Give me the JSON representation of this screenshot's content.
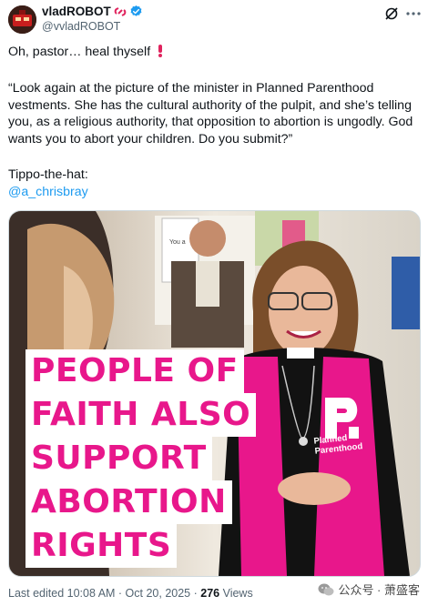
{
  "header": {
    "display_name": "vladROBOT",
    "handle": "@vvladROBOT"
  },
  "tweet": {
    "line1": "Oh, pastor… heal thyself",
    "line2": "“Look again at the picture of the minister in Planned Parenthood vestments. She has the cultural authority of the pulpit, and she’s telling you, as a religious authority, that opposition to abortion is ungodly. God wants you to abort your children. Do you submit?”",
    "line3": "Tippo-the-hat:",
    "mention": "@a_chrisbray"
  },
  "media": {
    "overlay_lines": [
      "PEOPLE OF",
      "FAITH ALSO",
      "SUPPORT",
      "ABORTION",
      "RIGHTS"
    ],
    "logo_text_1": "Planned",
    "logo_text_2": "Parenthood",
    "sign_text": "You a"
  },
  "footer": {
    "edited": "Last edited 10:08 AM · Oct 20, 2025 · ",
    "views_count": "276",
    "views_label": " Views"
  },
  "watermark": {
    "text": "公众号 · 萧盛客"
  },
  "colors": {
    "accent_blue": "#1d9bf0",
    "brand_pink": "#e8178b",
    "emoji_red": "#e0245e"
  },
  "icons": [
    "avatar-icon",
    "link-emoji-icon",
    "verified-badge-icon",
    "grok-icon",
    "more-icon",
    "exclamation-emoji-icon",
    "wechat-icon"
  ]
}
